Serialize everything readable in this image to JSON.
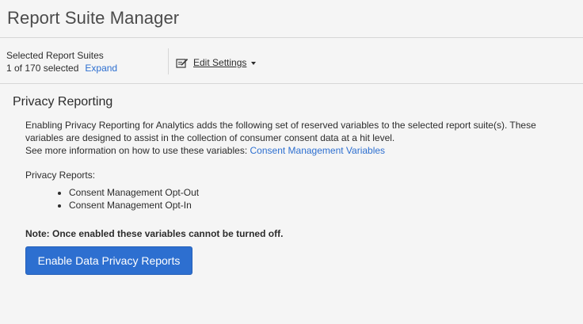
{
  "header": {
    "title": "Report Suite Manager"
  },
  "selector": {
    "label": "Selected Report Suites",
    "count_text": "1 of 170 selected",
    "expand_label": "Expand",
    "edit_settings_label": "Edit Settings",
    "edit_icon": "edit-pencil-icon",
    "dropdown_icon": "caret-down-icon"
  },
  "section": {
    "title": "Privacy Reporting",
    "description_lines": [
      "Enabling Privacy Reporting for Analytics adds the following set of reserved variables to the selected report suite(s). These",
      "variables are designed to assist in the collection of consumer consent data at a hit level.",
      "See more information on how to use these variables: "
    ],
    "link_label": "Consent Management Variables",
    "reports_label": "Privacy Reports:",
    "reports": [
      "Consent Management Opt-Out",
      "Consent Management Opt-In"
    ],
    "note": "Note: Once enabled these variables cannot be turned off.",
    "button_label": "Enable Data Privacy Reports"
  },
  "colors": {
    "accent": "#2d6fd0",
    "background": "#f5f5f5",
    "text": "#2c2c2c",
    "divider": "#d6d6d6"
  }
}
